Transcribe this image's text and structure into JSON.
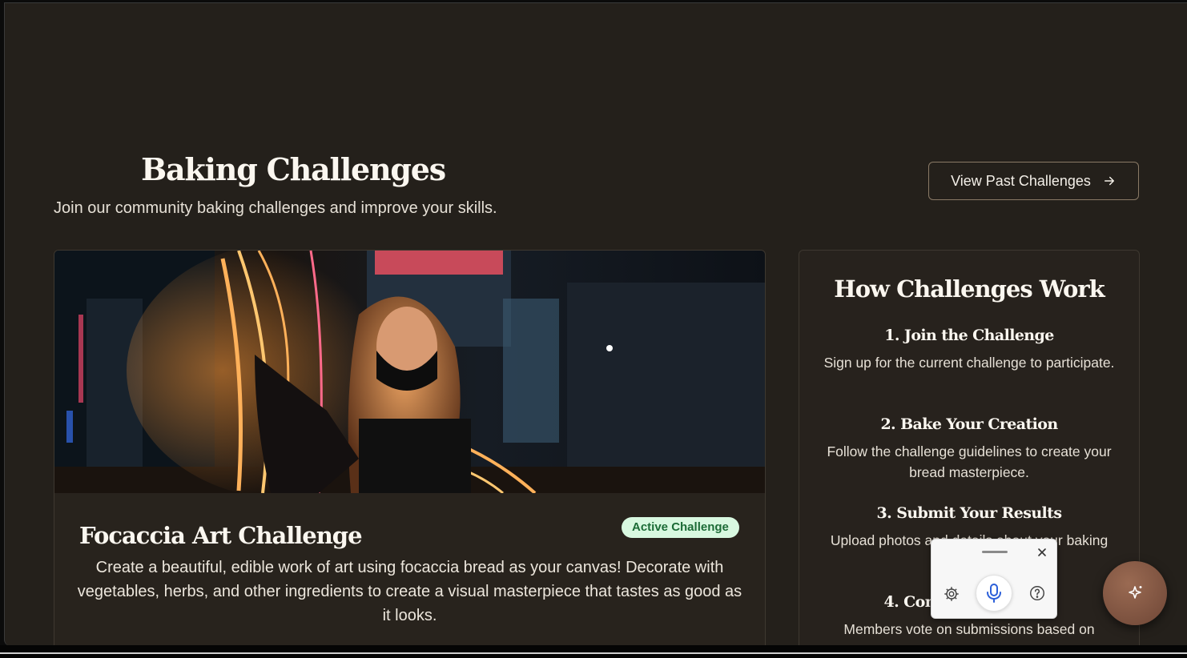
{
  "header": {
    "title": "Baking Challenges",
    "subtitle": "Join our community baking challenges and improve your skills.",
    "past_button_label": "View Past Challenges"
  },
  "active_challenge": {
    "title": "Focaccia Art Challenge",
    "badge": "Active Challenge",
    "description": "Create a beautiful, edible work of art using focaccia bread as your canvas! Decorate with vegetables, herbs, and other ingredients to create a visual masterpiece that tastes as good as it looks."
  },
  "how_it_works": {
    "title": "How Challenges Work",
    "steps": [
      {
        "title": "1. Join the Challenge",
        "description": "Sign up for the current challenge to participate."
      },
      {
        "title": "2. Bake Your Creation",
        "description": "Follow the challenge guidelines to create your bread masterpiece."
      },
      {
        "title": "3. Submit Your Results",
        "description": "Upload photos and details about your baking process."
      },
      {
        "title": "4. Community Voting",
        "description": "Members vote on submissions based on"
      }
    ]
  },
  "colors": {
    "background": "#24201b",
    "badge_bg": "#d8f8e0",
    "badge_text": "#1c6b36",
    "fab": "#7d5240",
    "mic": "#2b5fd9"
  },
  "icons": {
    "past_button": "arrow-right-icon",
    "widget_close": "close-icon",
    "widget_settings": "gear-icon",
    "widget_mic": "microphone-icon",
    "widget_help": "help-icon",
    "fab": "sparkle-icon"
  }
}
